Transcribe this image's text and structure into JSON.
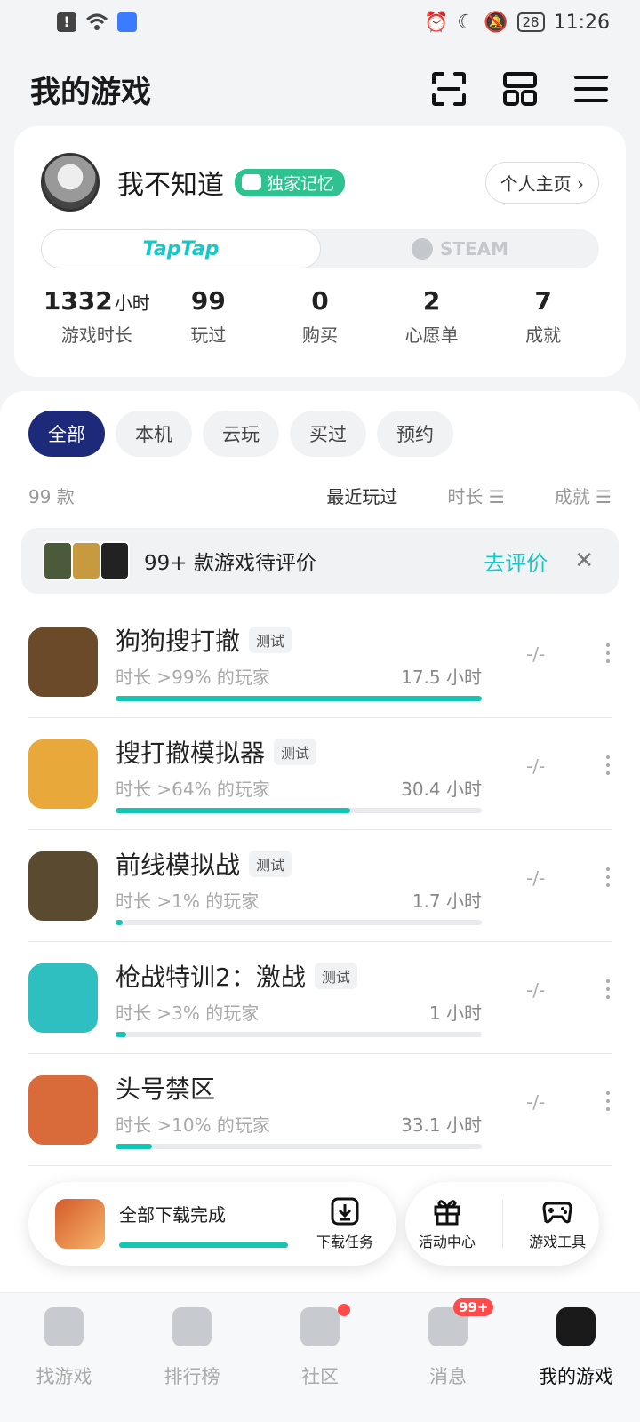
{
  "status_bar": {
    "time": "11:26",
    "battery": "28"
  },
  "header": {
    "title": "我的游戏",
    "scan_icon": "scan-icon",
    "layout_icon": "grid-icon",
    "menu_icon": "menu-icon"
  },
  "profile": {
    "username": "我不知道",
    "badge": "独家记忆",
    "homepage_label": "个人主页 ›",
    "platforms": [
      {
        "label": "TapTap"
      },
      {
        "label": "STEAM"
      }
    ],
    "stats": [
      {
        "value": "1332",
        "unit": "小时",
        "label": "游戏时长"
      },
      {
        "value": "99",
        "unit": "",
        "label": "玩过"
      },
      {
        "value": "0",
        "unit": "",
        "label": "购买"
      },
      {
        "value": "2",
        "unit": "",
        "label": "心愿单"
      },
      {
        "value": "7",
        "unit": "",
        "label": "成就"
      }
    ]
  },
  "filters": [
    "全部",
    "本机",
    "云玩",
    "买过",
    "预约"
  ],
  "list_header": {
    "count": "99 款",
    "sort_recent": "最近玩过",
    "sort_duration": "时长 ☰",
    "sort_achievement": "成就 ☰"
  },
  "review_banner": {
    "text": "99+ 款游戏待评价",
    "action": "去评价",
    "close": "✕"
  },
  "games": [
    {
      "name": "狗狗搜打撤",
      "tag": "测试",
      "rank_text": "时长 >99% 的玩家",
      "hours": "17.5 小时",
      "progress": 1.0,
      "achievement": "-/-",
      "color": "#6b4a2a"
    },
    {
      "name": "搜打撤模拟器",
      "tag": "测试",
      "rank_text": "时长 >64% 的玩家",
      "hours": "30.4 小时",
      "progress": 0.64,
      "achievement": "-/-",
      "color": "#e8a93a"
    },
    {
      "name": "前线模拟战",
      "tag": "测试",
      "rank_text": "时长 >1% 的玩家",
      "hours": "1.7 小时",
      "progress": 0.01,
      "achievement": "-/-",
      "color": "#5a4a30"
    },
    {
      "name": "枪战特训2：激战",
      "tag": "测试",
      "rank_text": "时长 >3% 的玩家",
      "hours": "1 小时",
      "progress": 0.03,
      "achievement": "-/-",
      "color": "#2fbfc1"
    },
    {
      "name": "头号禁区",
      "tag": "",
      "rank_text": "时长 >10% 的玩家",
      "hours": "33.1 小时",
      "progress": 0.1,
      "achievement": "-/-",
      "color": "#d96a3a"
    }
  ],
  "download_bar": {
    "status": "全部下载完成",
    "task_label": "下载任务"
  },
  "quick_actions": {
    "activity": "活动中心",
    "tools": "游戏工具"
  },
  "bottom_nav": [
    {
      "label": "找游戏",
      "icon": "find-game-icon"
    },
    {
      "label": "排行榜",
      "icon": "ranking-icon"
    },
    {
      "label": "社区",
      "icon": "community-icon"
    },
    {
      "label": "消息",
      "icon": "message-icon",
      "badge": "99+"
    },
    {
      "label": "我的游戏",
      "icon": "my-games-icon"
    }
  ]
}
